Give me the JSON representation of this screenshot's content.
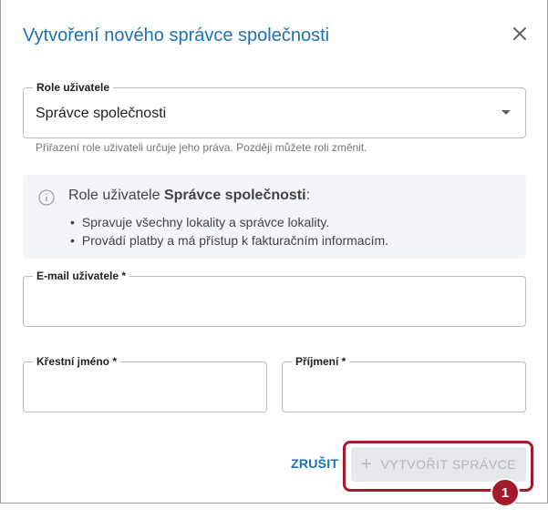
{
  "dialog": {
    "title": "Vytvoření nového správce společnosti"
  },
  "role_field": {
    "label": "Role uživatele",
    "value": "Správce společnosti",
    "helper": "Přiřazení role uživateli určuje jeho práva. Později můžete roli změnit."
  },
  "info": {
    "title_prefix": "Role uživatele ",
    "title_role": "Správce společnosti",
    "title_suffix": ":",
    "items": [
      "Spravuje všechny lokality a správce lokality.",
      "Provádí platby a má přístup k fakturačním informacím."
    ]
  },
  "email_field": {
    "label": "E-mail uživatele *",
    "value": ""
  },
  "first_name_field": {
    "label": "Křestní jméno *",
    "value": ""
  },
  "last_name_field": {
    "label": "Příjmení *",
    "value": ""
  },
  "actions": {
    "cancel_label": "ZRUŠIT",
    "create_label": "VYTVOŘIT SPRÁVCE",
    "create_icon": "+"
  },
  "annotation": {
    "step": "1"
  },
  "colors": {
    "primary": "#1a73b5",
    "disabled_bg": "#e6e9ec",
    "disabled_text": "#b0b7be",
    "highlight": "#a31a2c",
    "info_bg": "#f3f6f9"
  }
}
